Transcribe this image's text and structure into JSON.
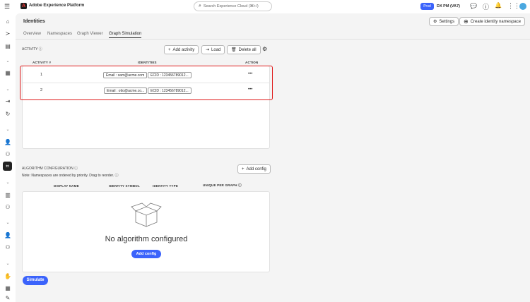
{
  "topbar": {
    "app_title": "Adobe Experience Platform",
    "search_placeholder": "Search Experience Cloud (⌘+/)",
    "env_badge": "Prod",
    "org": "DX PM (VA7)"
  },
  "page": {
    "title": "Identities",
    "tabs": [
      "Overview",
      "Namespaces",
      "Graph Viewer",
      "Graph Simulation"
    ],
    "active_tab": "Graph Simulation",
    "settings_label": "Settings",
    "create_label": "Create identity namespace"
  },
  "activity": {
    "title": "ACTIVITY",
    "add_label": "Add activity",
    "load_label": "Load",
    "delete_label": "Delete all",
    "columns": [
      "ACTIVITY #",
      "IDENTITIES",
      "ACTION"
    ],
    "rows": [
      {
        "num": "1",
        "ids": [
          "Email : sam@acme.com",
          "ECID : 123456789012..."
        ],
        "action": "•••"
      },
      {
        "num": "2",
        "ids": [
          "Email : otto@acme.co...",
          "ECID : 123456789012..."
        ],
        "action": "•••"
      }
    ]
  },
  "algorithm": {
    "title": "ALGORITHM CONFIGURATION",
    "note": "Note: Namespaces are ordered by priority. Drag to reorder.",
    "add_label": "Add config",
    "columns": [
      "DISPLAY NAME",
      "IDENTITY SYMBOL",
      "IDENTITY TYPE",
      "UNIQUE PER GRAPH"
    ],
    "empty_text": "No algorithm configured",
    "empty_button": "Add config"
  },
  "simulate_label": "Simulate",
  "colors": {
    "accent": "#3b63fb",
    "highlight": "#e01b1b"
  }
}
